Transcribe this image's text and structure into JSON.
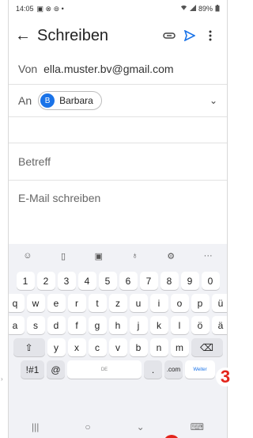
{
  "statusbar": {
    "time": "14:05",
    "left_icons": "▣ ⊗ ⊚ •",
    "battery": "89%"
  },
  "appbar": {
    "title": "Schreiben"
  },
  "from": {
    "label": "Von",
    "value": "ella.muster.bv@gmail.com"
  },
  "to": {
    "label": "An",
    "recipient_initial": "B",
    "recipient": "Barbara"
  },
  "subject": {
    "placeholder": "Betreff"
  },
  "body": {
    "placeholder": "E-Mail schreiben"
  },
  "keyboard": {
    "numbers": [
      "1",
      "2",
      "3",
      "4",
      "5",
      "6",
      "7",
      "8",
      "9",
      "0"
    ],
    "row1": [
      "q",
      "w",
      "e",
      "r",
      "t",
      "z",
      "u",
      "i",
      "o",
      "p",
      "ü"
    ],
    "row2": [
      "a",
      "s",
      "d",
      "f",
      "g",
      "h",
      "j",
      "k",
      "l",
      "ö",
      "ä"
    ],
    "row3": [
      "y",
      "x",
      "c",
      "v",
      "b",
      "n",
      "m"
    ],
    "sym_label": "!#1",
    "at_label": "@",
    "space_label": "DE",
    "dot_label": ".",
    "com_label": ".com",
    "go_label": "Weiter"
  },
  "annotation": {
    "step_number": "3",
    "side_hint": "›"
  },
  "colors": {
    "accent": "#1a73e8",
    "annotation": "#e3241b"
  }
}
